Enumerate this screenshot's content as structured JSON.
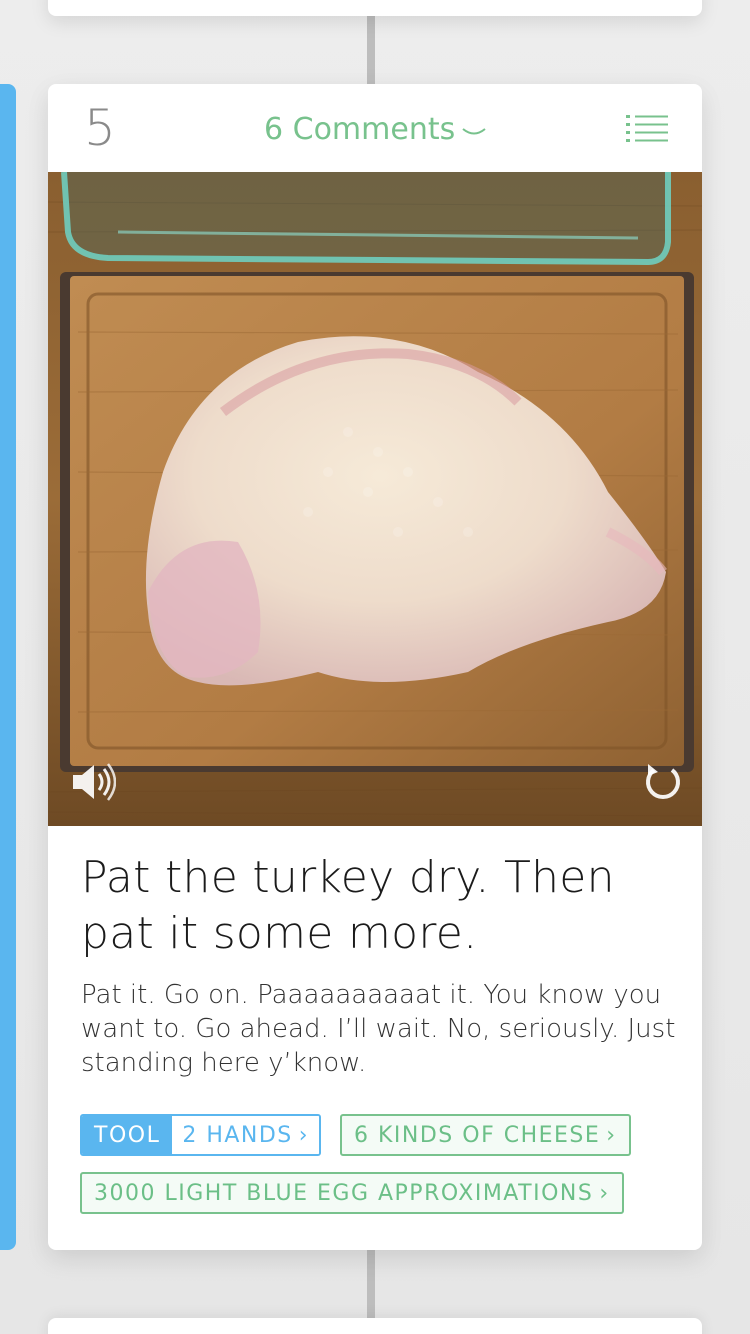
{
  "card": {
    "step_number": "5",
    "comments_label": "6 Comments",
    "title": "Pat the turkey dry. Then pat it some more.",
    "description": "Pat it. Go on. Paaaaaaaaaat it. You know you want to. Go ahead. I’ll wait. No, seriously. Just standing here y’know.",
    "media": {
      "sound_icon": "speaker-icon",
      "replay_icon": "replay-icon"
    },
    "tags": {
      "tool_label": "TOOL",
      "tool_value": "2 HANDS",
      "ingredient_1": "6 KINDS OF CHEESE",
      "ingredient_2": "3000 LIGHT BLUE EGG APPROXIMATIONS",
      "arrow": "›"
    }
  },
  "colors": {
    "accent_blue": "#5ab6ef",
    "accent_green": "#78c28d",
    "step_gray": "#8a8a8a"
  }
}
